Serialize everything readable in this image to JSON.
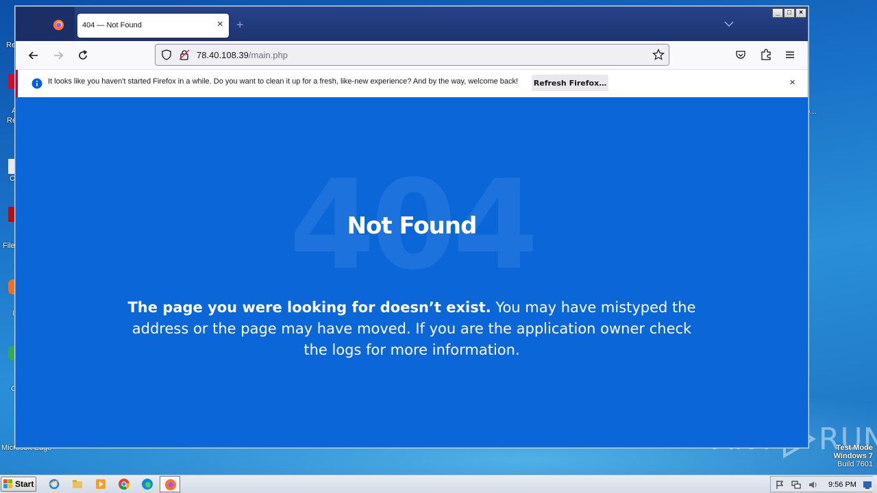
{
  "desktop": {
    "labels": [
      "Re",
      "A",
      "Re",
      "C",
      "File",
      "I",
      "C",
      "Microsoft Edge",
      "o..."
    ],
    "watermark": {
      "left": "ANY",
      "right": "RUN"
    },
    "test_mode": [
      "Test Mode",
      "Windows 7",
      "Build 7601"
    ]
  },
  "browser": {
    "tab": {
      "title": "404 — Not Found",
      "close": "×"
    },
    "new_tab": "+",
    "window_buttons": {
      "minimize": "_",
      "maximize": "□",
      "close": "×"
    },
    "url": {
      "host": "78.40.108.39",
      "path": "/main.php"
    },
    "notification": {
      "text": "It looks like you haven't started Firefox in a while. Do you want to clean it up for a fresh, like-new experience? And by the way, welcome back!",
      "button": "Refresh Firefox…",
      "close": "×"
    },
    "colors": {
      "page_bg": "#0b66d8",
      "accent": "#0060df",
      "notif_stripe": "#d70022"
    }
  },
  "page": {
    "code": "404",
    "title": "Not Found",
    "message_bold": "The page you were looking for doesn’t exist.",
    "message_rest": " You may have mistyped the address or the page may have moved. If you are the application owner check the logs for more information."
  },
  "taskbar": {
    "start": "Start",
    "clock": "9:56 PM",
    "icons": [
      "ie-icon",
      "explorer-icon",
      "media-player-icon",
      "chrome-icon",
      "edge-icon",
      "firefox-icon"
    ]
  }
}
